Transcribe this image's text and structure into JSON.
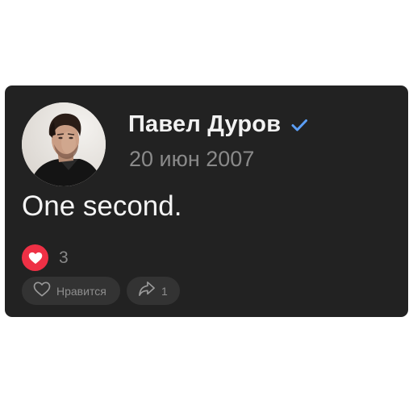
{
  "post": {
    "author": {
      "name": "Павел Дуров",
      "verified": true,
      "verified_color": "#5b9ef5",
      "avatar_icon": "user-avatar-photo"
    },
    "date": "20 июн 2007",
    "text": "One second.",
    "reactions": {
      "icon": "heart-icon",
      "badge_color": "#ee3045",
      "count": "3"
    },
    "actions": {
      "like_label": "Нравится",
      "like_icon": "heart-outline-icon",
      "share_count": "1",
      "share_icon": "share-arrow-icon"
    }
  },
  "theme": {
    "card_background": "#222222",
    "button_background": "#333333"
  }
}
